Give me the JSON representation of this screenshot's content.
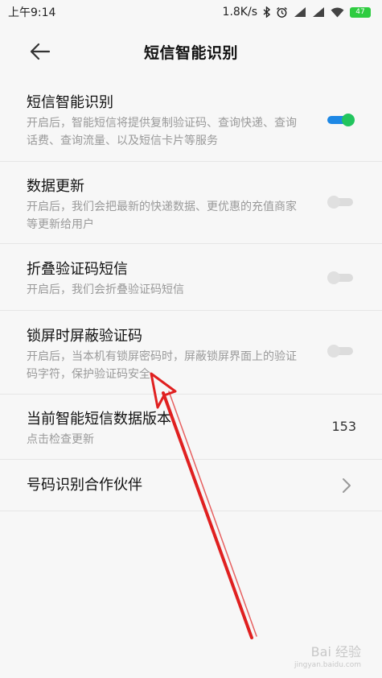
{
  "status": {
    "time": "上午9:14",
    "speed": "1.8K/s",
    "battery": "47"
  },
  "header": {
    "title": "短信智能识别"
  },
  "settings": [
    {
      "title": "短信智能识别",
      "desc": "开启后，智能短信将提供复制验证码、查询快递、查询话费、查询流量、以及短信卡片等服务",
      "toggle": true
    },
    {
      "title": "数据更新",
      "desc": "开启后，我们会把最新的快递数据、更优惠的充值商家等更新给用户",
      "toggle": false
    },
    {
      "title": "折叠验证码短信",
      "desc": "开启后，我们会折叠验证码短信",
      "toggle": false
    },
    {
      "title": "锁屏时屏蔽验证码",
      "desc": "开启后，当本机有锁屏密码时，屏蔽锁屏界面上的验证码字符，保护验证码安全",
      "toggle": false
    }
  ],
  "version": {
    "title": "当前智能短信数据版本",
    "desc": "点击检查更新",
    "value": "153"
  },
  "partners": {
    "title": "号码识别合作伙伴"
  },
  "watermark": {
    "brand": "Bai 经验",
    "url": "jingyan.baidu.com"
  },
  "colors": {
    "toggle_on_track": "#1e88e5",
    "toggle_on_knob": "#22c55e",
    "annotation_arrow": "#e02020"
  }
}
